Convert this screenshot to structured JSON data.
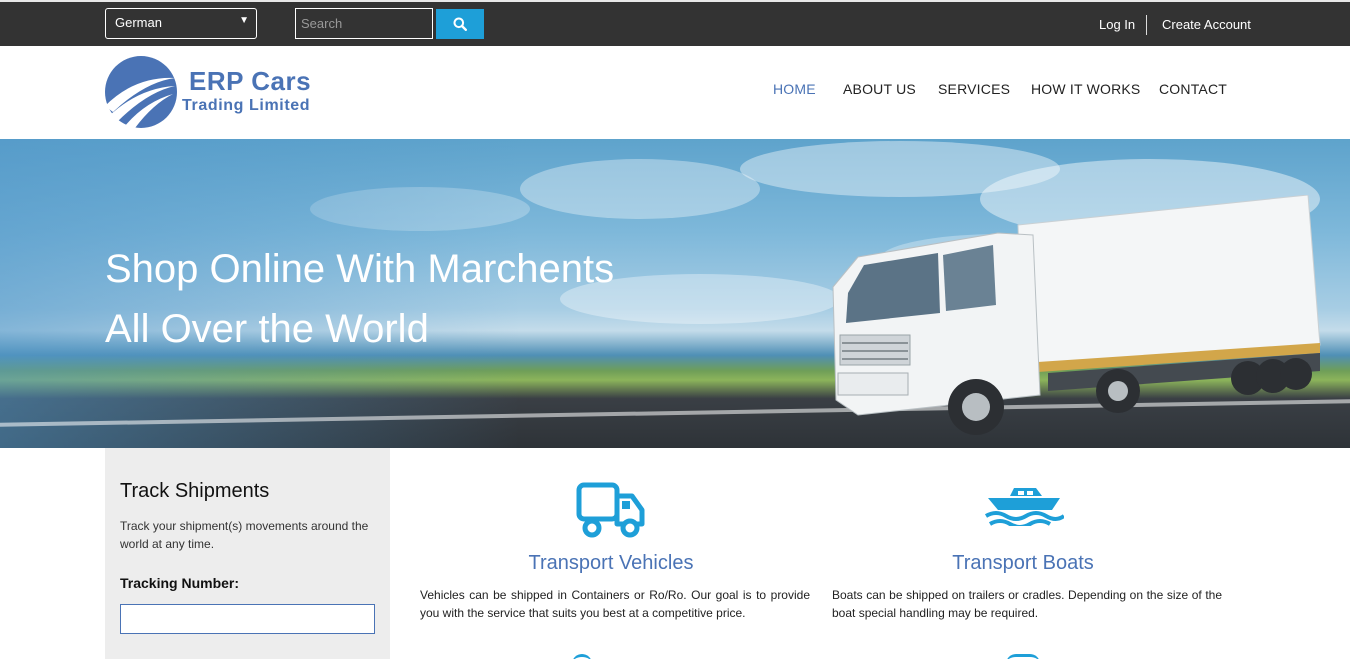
{
  "topbar": {
    "language": "German",
    "search_placeholder": "Search",
    "login": "Log In",
    "create_account": "Create Account"
  },
  "brand": {
    "name": "ERP Cars",
    "subtitle": "Trading Limited",
    "color": "#4a73b5"
  },
  "nav": {
    "items": [
      {
        "label": "HOME",
        "active": true
      },
      {
        "label": "ABOUT US"
      },
      {
        "label": "SERVICES"
      },
      {
        "label": "HOW IT WORKS"
      },
      {
        "label": "CONTACT"
      }
    ]
  },
  "hero": {
    "line1": "Shop Online With Marchents",
    "line2": "All Over the World"
  },
  "track": {
    "title": "Track Shipments",
    "description": "Track your shipment(s) movements around the world at any time.",
    "label": "Tracking Number:",
    "value": ""
  },
  "services": [
    {
      "icon": "truck-icon",
      "title": "Transport Vehicles",
      "description": "Vehicles can be shipped in Containers or Ro/Ro. Our goal is to provide you with the service that suits you best at a competitive price."
    },
    {
      "icon": "boat-icon",
      "title": "Transport Boats",
      "description": "Boats can be shipped on trailers or cradles. Depending on the size of the boat special handling may be required."
    }
  ],
  "colors": {
    "accent": "#1e9fd8",
    "topbar": "#333333",
    "panel": "#ededed"
  }
}
